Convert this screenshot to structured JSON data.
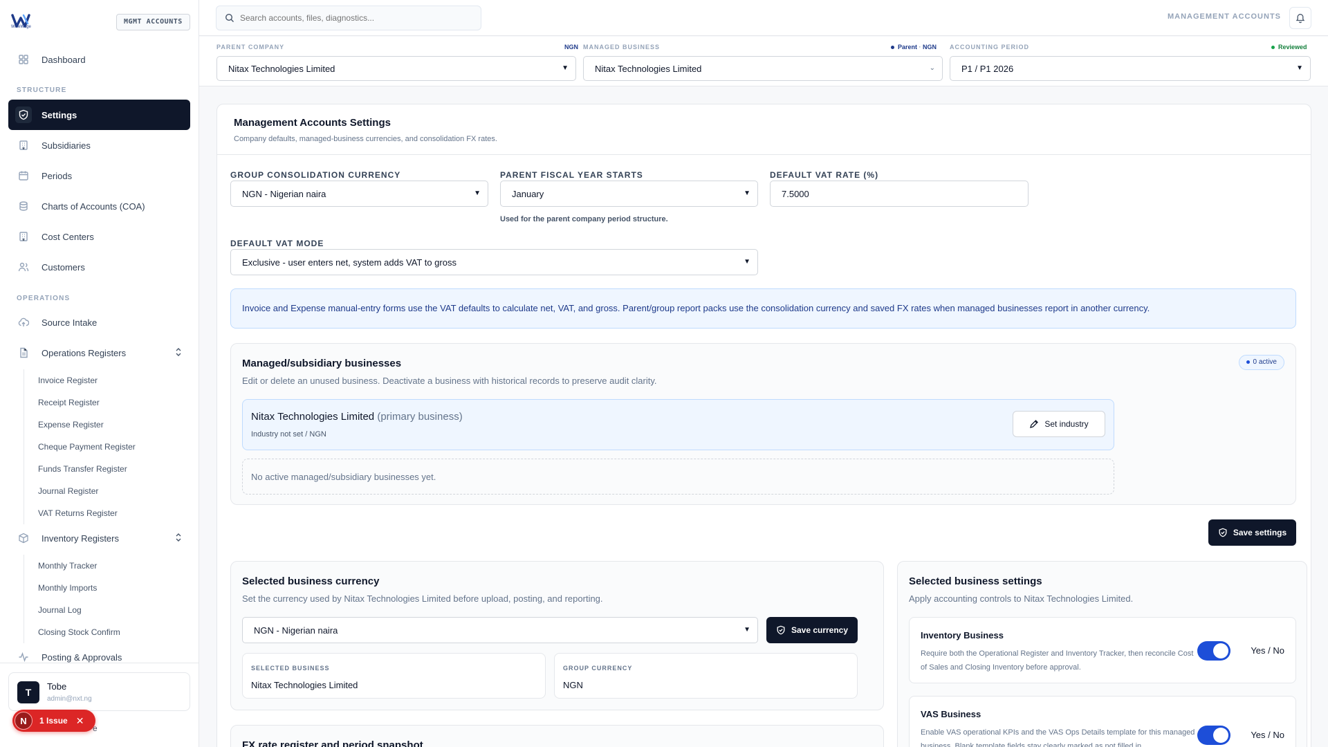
{
  "brand": {
    "logo_text": "WiseWage",
    "badge": "MGMT ACCOUNTS"
  },
  "sidebar": {
    "dashboard": "Dashboard",
    "structure_label": "STRUCTURE",
    "structure": [
      "Settings",
      "Subsidiaries",
      "Periods",
      "Charts of Accounts (COA)",
      "Cost Centers",
      "Customers"
    ],
    "operations_label": "OPERATIONS",
    "source_intake": "Source Intake",
    "operations_registers": "Operations Registers",
    "operations_sub": [
      "Invoice Register",
      "Receipt Register",
      "Expense Register",
      "Cheque Payment Register",
      "Funds Transfer Register",
      "Journal Register",
      "VAT Returns Register"
    ],
    "inventory_registers": "Inventory Registers",
    "inventory_sub": [
      "Monthly Tracker",
      "Monthly Imports",
      "Journal Log",
      "Closing Stock Confirm"
    ],
    "posting": "Posting & Approvals",
    "tail": "e"
  },
  "user": {
    "initial": "T",
    "name": "Tobe",
    "email": "admin@nxt.ng"
  },
  "issue": {
    "initial": "N",
    "label": "1 Issue"
  },
  "topbar": {
    "search_placeholder": "Search accounts, files, diagnostics...",
    "label": "MANAGEMENT ACCOUNTS"
  },
  "context": {
    "parent_label": "PARENT COMPANY",
    "parent_currency": "NGN",
    "parent_value": "Nitax Technologies Limited",
    "managed_label": "MANAGED BUSINESS",
    "managed_meta_parent": "Parent",
    "managed_meta_currency": "NGN",
    "managed_value": "Nitax Technologies Limited",
    "period_label": "ACCOUNTING PERIOD",
    "period_status": "Reviewed",
    "period_value": "P1 / P1 2026"
  },
  "settings": {
    "title": "Management Accounts Settings",
    "subtitle": "Company defaults, managed-business currencies, and consolidation FX rates.",
    "group_currency_label": "GROUP CONSOLIDATION CURRENCY",
    "group_currency_value": "NGN - Nigerian naira",
    "fiscal_label": "PARENT FISCAL YEAR STARTS",
    "fiscal_value": "January",
    "fiscal_help": "Used for the parent company period structure.",
    "vat_rate_label": "DEFAULT VAT RATE (%)",
    "vat_rate_value": "7.5000",
    "vat_mode_label": "DEFAULT VAT MODE",
    "vat_mode_value": "Exclusive - user enters net, system adds VAT to gross",
    "info": "Invoice and Expense manual-entry forms use the VAT defaults to calculate net, VAT, and gross. Parent/group report packs use the consolidation currency and saved FX rates when managed businesses report in another currency.",
    "save_label": "Save settings"
  },
  "managed": {
    "title": "Managed/subsidiary businesses",
    "subtitle": "Edit or delete an unused business. Deactivate a business with historical records to preserve audit clarity.",
    "active_badge": "0 active",
    "primary_name": "Nitax Technologies Limited",
    "primary_tag": "(primary business)",
    "primary_meta": "Industry not set / NGN",
    "set_industry": "Set industry",
    "empty": "No active managed/subsidiary businesses yet."
  },
  "currency_panel": {
    "title": "Selected business currency",
    "subtitle": "Set the currency used by Nitax Technologies Limited before upload, posting, and reporting.",
    "currency_value": "NGN - Nigerian naira",
    "save_label": "Save currency",
    "selected_label": "SELECTED BUSINESS",
    "selected_value": "Nitax Technologies Limited",
    "group_label": "GROUP CURRENCY",
    "group_value": "NGN"
  },
  "fx_panel": {
    "title": "FX rate register and period snapshot"
  },
  "business_settings": {
    "title": "Selected business settings",
    "subtitle": "Apply accounting controls to Nitax Technologies Limited.",
    "inventory_title": "Inventory Business",
    "inventory_desc": "Require both the Operational Register and Inventory Tracker, then reconcile Cost of Sales and Closing Inventory before approval.",
    "inventory_toggle": "Yes / No",
    "vas_title": "VAS Business",
    "vas_desc": "Enable VAS operational KPIs and the VAS Ops Details template for this managed business. Blank template fields stay clearly marked as not filled in.",
    "vas_toggle": "Yes / No"
  },
  "colors": {
    "accent": "#0f172a",
    "toggle": "#1d4ed8",
    "info_bg": "#eff6ff",
    "issue": "#dc2626",
    "status_green": "#16a34a"
  }
}
